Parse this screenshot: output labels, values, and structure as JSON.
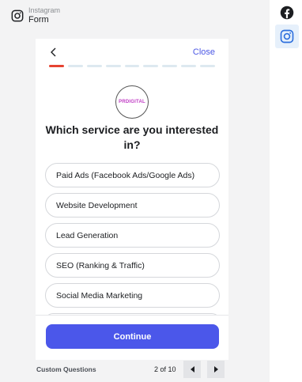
{
  "header": {
    "platform": "Instagram",
    "title": "Form",
    "icon": "instagram-icon"
  },
  "form": {
    "close_label": "Close",
    "progress": {
      "current_step": 1,
      "total_segments": 9
    },
    "logo_text": "PRDIGITAL",
    "question": "Which service are you interested in?",
    "options": [
      "Paid Ads (Facebook Ads/Google Ads)",
      "Website Development",
      "Lead Generation",
      "SEO (Ranking & Traffic)",
      "Social Media Marketing"
    ],
    "continue_label": "Continue"
  },
  "footer": {
    "section_label": "Custom Questions",
    "page_indicator": "2 of 10"
  },
  "rail": {
    "items": [
      {
        "name": "facebook",
        "icon": "facebook-icon"
      },
      {
        "name": "instagram",
        "icon": "instagram-icon",
        "selected": true
      }
    ]
  },
  "colors": {
    "accent": "#4b57ea",
    "progress_active": "#e64331",
    "progress_inactive": "#dde9f0"
  }
}
